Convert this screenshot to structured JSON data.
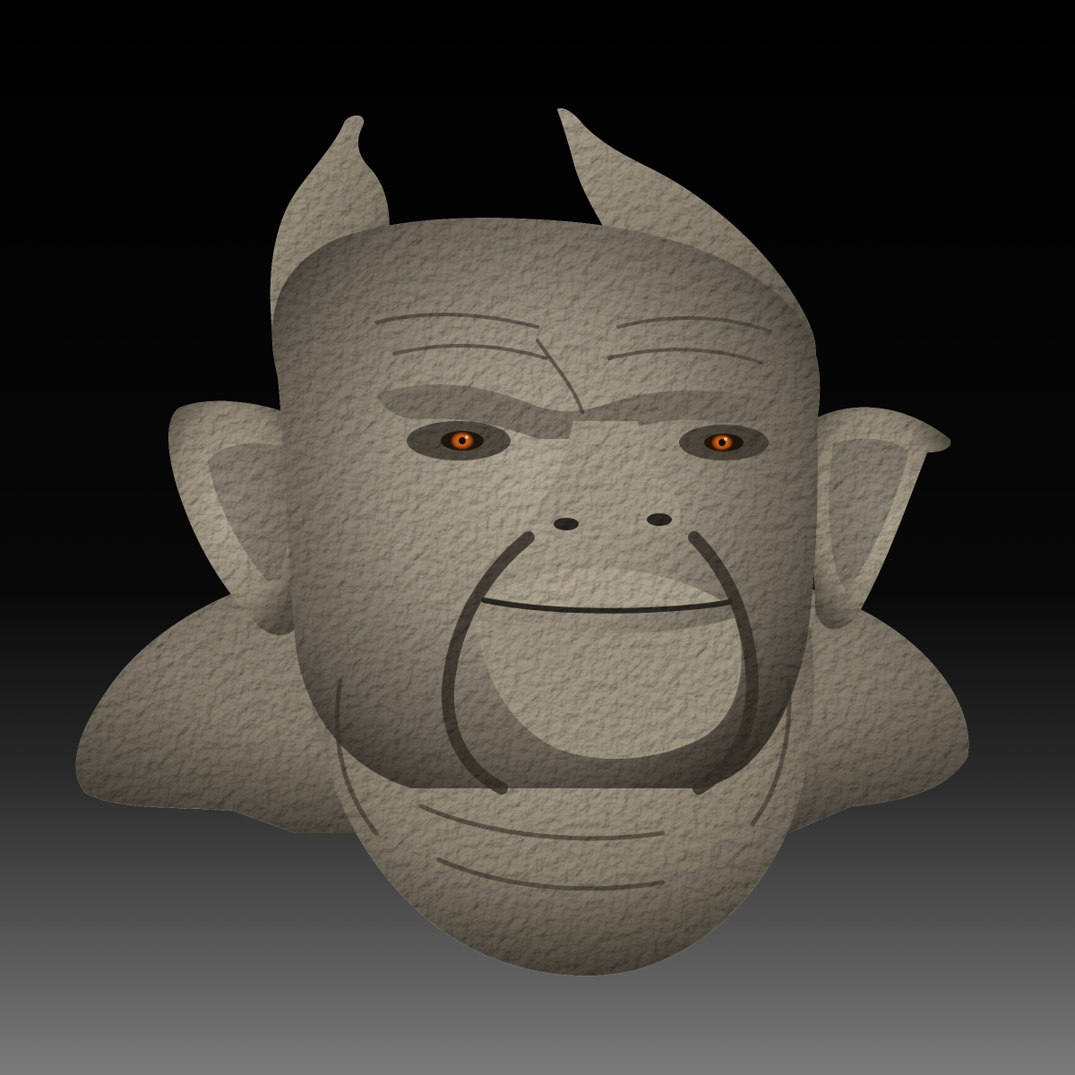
{
  "scene": {
    "subject": "",
    "colors": {
      "background_top": "#000000",
      "background_mid": "#0a0a0a",
      "background_bottom": "#7a7a7a",
      "clay_light": "#c9bfae",
      "clay_mid": "#9a9080",
      "clay_dark": "#5e564a",
      "clay_shadow": "#2e2a24",
      "eye_iris": "#c8601a",
      "eye_pupil": "#1a0c04"
    }
  }
}
